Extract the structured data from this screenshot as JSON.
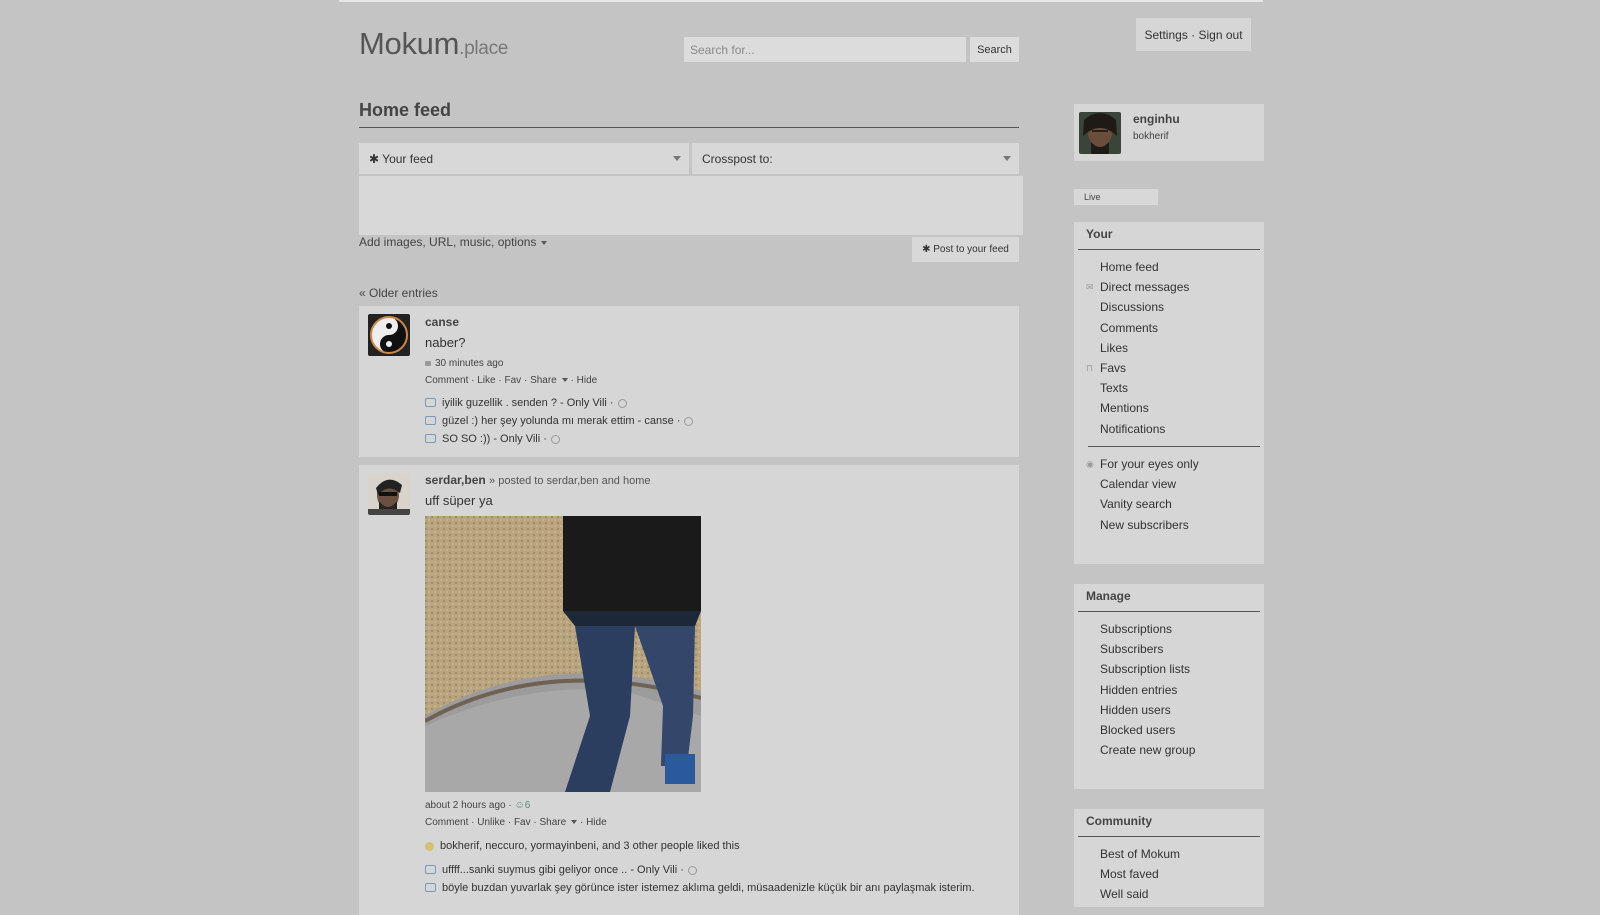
{
  "header": {
    "logo_main": "Mokum",
    "logo_suffix": ".place",
    "search_placeholder": "Search for...",
    "search_button": "Search",
    "settings_link": "Settings",
    "separator": "·",
    "signout_link": "Sign out"
  },
  "page_title": "Home feed",
  "composer": {
    "feed_select": "✱ Your feed",
    "crosspost_select": "Crosspost to:",
    "add_options": "Add images, URL, music, options",
    "post_button": "✱ Post to your feed"
  },
  "older_entries": "« Older entries",
  "entries": [
    {
      "author": "canse",
      "text": "naber?",
      "time": "30 minutes ago",
      "actions": [
        "Comment",
        "Like",
        "Fav",
        "Share",
        "Hide"
      ],
      "comments": [
        "iyilik guzellik . senden ? - Only Vili ·",
        "güzel :) her şey yolunda mı merak ettim - canse ·",
        "SO SO :)) - Only Vili ·"
      ]
    },
    {
      "author": "serdar,ben",
      "posted_to": "» posted to serdar,ben and home",
      "text": "uff süper ya",
      "time": "about 2 hours ago ·",
      "reactions": "6",
      "actions": [
        "Comment",
        "Unlike",
        "Fav",
        "Share",
        "Hide"
      ],
      "likes": "bokherif, neccuro, yormayinbeni, and 3 other people liked this",
      "comments": [
        "uffff...sanki suymus gibi geliyor once .. - Only Vili ·",
        "böyle buzdan yuvarlak şey görünce ister istemez aklıma geldi, müsaadenizle küçük bir anı paylaşmak isterim."
      ]
    }
  ],
  "profile": {
    "name": "enginhu",
    "sub": "bokherif"
  },
  "live_label": "Live",
  "sidebar": {
    "your": {
      "title": "Your",
      "items": [
        "Home feed",
        "Direct messages",
        "Discussions",
        "Comments",
        "Likes",
        "Favs",
        "Texts",
        "Mentions",
        "Notifications"
      ],
      "items2": [
        "For your eyes only",
        "Calendar view",
        "Vanity search",
        "New subscribers"
      ]
    },
    "manage": {
      "title": "Manage",
      "items": [
        "Subscriptions",
        "Subscribers",
        "Subscription lists",
        "Hidden entries",
        "Hidden users",
        "Blocked users",
        "Create new group"
      ]
    },
    "community": {
      "title": "Community",
      "items": [
        "Best of Mokum",
        "Most faved",
        "Well said"
      ]
    }
  }
}
